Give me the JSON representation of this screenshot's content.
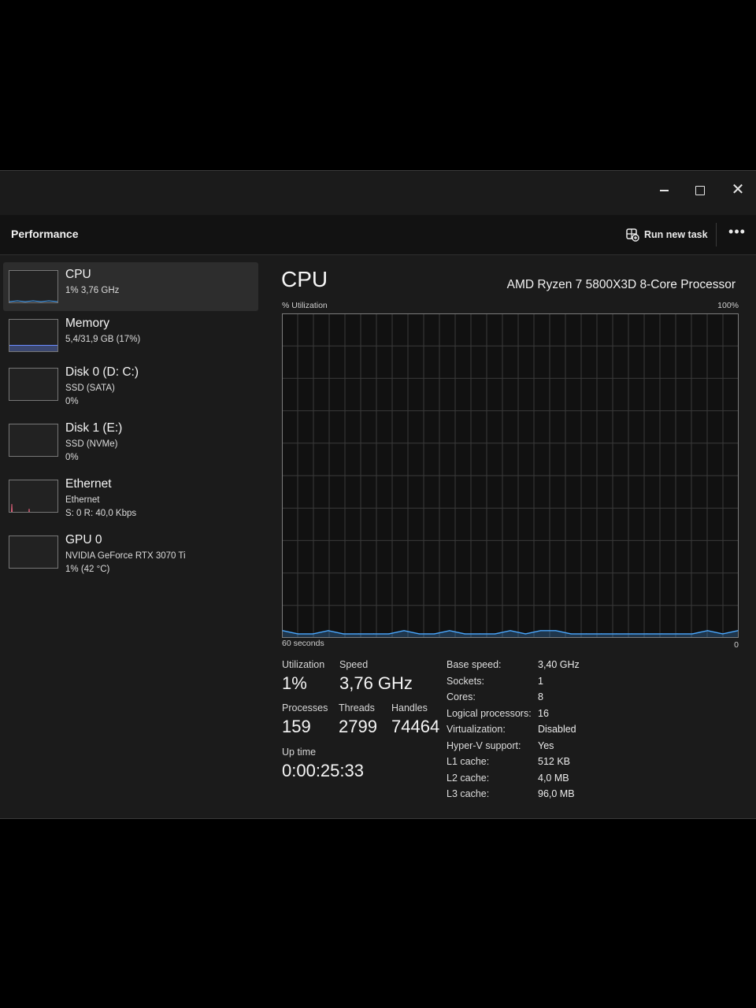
{
  "window": {
    "minimize_icon": "minimize-icon",
    "maximize_icon": "maximize-icon",
    "close_icon": "close-icon",
    "close_glyph": "✕"
  },
  "header": {
    "title": "Performance",
    "run_new_task": "Run new task",
    "run_icon": "run-task-icon",
    "more_glyph": "•••"
  },
  "sidebar": {
    "items": [
      {
        "name": "CPU",
        "line1": "1%  3,76 GHz",
        "line2": "",
        "active": true,
        "graph_color": "#4aa8ff"
      },
      {
        "name": "Memory",
        "line1": "5,4/31,9 GB (17%)",
        "line2": "",
        "active": false,
        "graph_color": "#6b8cff",
        "fill_fraction": 0.17
      },
      {
        "name": "Disk 0 (D: C:)",
        "line1": "SSD (SATA)",
        "line2": "0%",
        "active": false
      },
      {
        "name": "Disk 1 (E:)",
        "line1": "SSD (NVMe)",
        "line2": "0%",
        "active": false
      },
      {
        "name": "Ethernet",
        "line1": "Ethernet",
        "line2": "S: 0  R: 40,0 Kbps",
        "active": false,
        "graph_color": "#e0607a"
      },
      {
        "name": "GPU 0",
        "line1": "NVIDIA GeForce RTX 3070 Ti",
        "line2": "1%  (42 °C)",
        "active": false
      }
    ]
  },
  "main": {
    "title": "CPU",
    "model": "AMD Ryzen 7 5800X3D 8-Core Processor",
    "util_axis_label": "% Utilization",
    "max_label": "100%",
    "time_label": "60 seconds",
    "min_label": "0",
    "stats": {
      "utilization_label": "Utilization",
      "utilization": "1%",
      "speed_label": "Speed",
      "speed": "3,76 GHz",
      "processes_label": "Processes",
      "processes": "159",
      "threads_label": "Threads",
      "threads": "2799",
      "handles_label": "Handles",
      "handles": "74464",
      "uptime_label": "Up time",
      "uptime": "0:00:25:33"
    },
    "info": [
      {
        "key": "Base speed:",
        "value": "3,40 GHz"
      },
      {
        "key": "Sockets:",
        "value": "1"
      },
      {
        "key": "Cores:",
        "value": "8"
      },
      {
        "key": "Logical processors:",
        "value": "16"
      },
      {
        "key": "Virtualization:",
        "value": "Disabled"
      },
      {
        "key": "Hyper-V support:",
        "value": "Yes"
      },
      {
        "key": "L1 cache:",
        "value": "512 KB"
      },
      {
        "key": "L2 cache:",
        "value": "4,0 MB"
      },
      {
        "key": "L3 cache:",
        "value": "96,0 MB"
      }
    ]
  },
  "chart_data": {
    "type": "area",
    "xlim": [
      60,
      0
    ],
    "ylim": [
      0,
      100
    ],
    "grid": true,
    "line_color": "#4aa8ff",
    "x": [
      60,
      58,
      56,
      54,
      52,
      50,
      48,
      46,
      44,
      42,
      40,
      38,
      36,
      34,
      32,
      30,
      28,
      26,
      24,
      22,
      20,
      18,
      16,
      14,
      12,
      10,
      8,
      6,
      4,
      2,
      0
    ],
    "values": [
      2,
      1,
      1,
      2,
      1,
      1,
      1,
      1,
      2,
      1,
      1,
      2,
      1,
      1,
      1,
      2,
      1,
      2,
      2,
      1,
      1,
      1,
      1,
      1,
      1,
      1,
      1,
      1,
      2,
      1,
      2
    ]
  }
}
